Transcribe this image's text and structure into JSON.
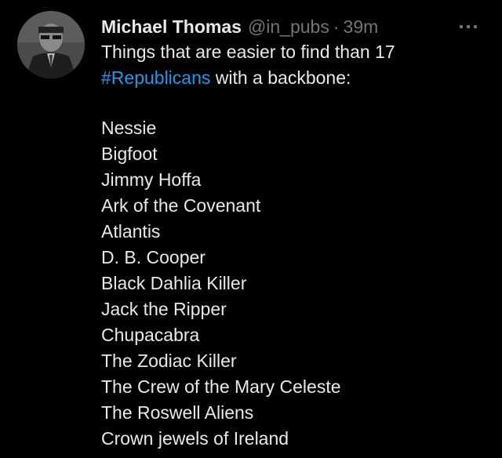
{
  "tweet": {
    "author": {
      "display_name": "Michael Thomas",
      "handle": "@in_pubs",
      "avatar_icon": "avatar-photo"
    },
    "separator": "·",
    "time": "39m",
    "more_icon": "more-options-icon",
    "text": {
      "line1": "Things that are easier to find than 17",
      "hashtag": "#Republicans",
      "line2_rest": " with a backbone:"
    },
    "items": [
      "Nessie",
      "Bigfoot",
      "Jimmy Hoffa",
      "Ark of the Covenant",
      "Atlantis",
      "D. B. Cooper",
      "Black Dahlia Killer",
      "Jack the Ripper",
      "Chupacabra",
      "The Zodiac Killer",
      "The Crew of the Mary Celeste",
      "The Roswell Aliens",
      "Crown jewels of Ireland"
    ],
    "colors": {
      "background": "#000000",
      "text": "#e7e9ea",
      "secondary": "#71767b",
      "link": "#1d9bf0"
    }
  }
}
